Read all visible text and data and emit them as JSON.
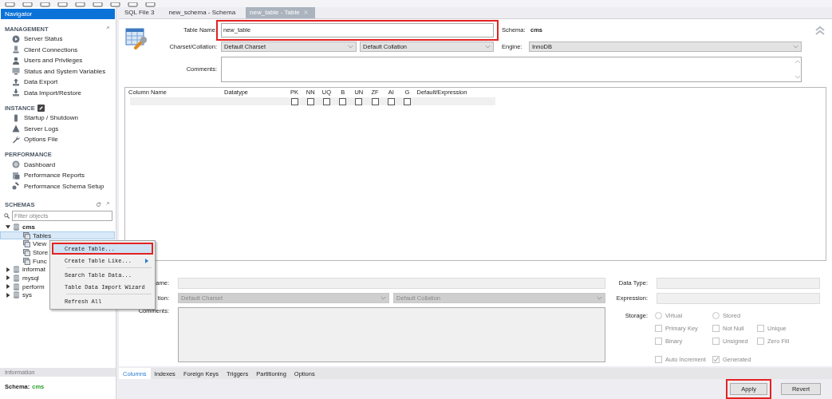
{
  "navigator": {
    "title": "Navigator",
    "sections": [
      {
        "title": "MANAGEMENT",
        "items": [
          "Server Status",
          "Client Connections",
          "Users and Privileges",
          "Status and System Variables",
          "Data Export",
          "Data Import/Restore"
        ]
      },
      {
        "title": "INSTANCE",
        "items": [
          "Startup / Shutdown",
          "Server Logs",
          "Options File"
        ]
      },
      {
        "title": "PERFORMANCE",
        "items": [
          "Dashboard",
          "Performance Reports",
          "Performance Schema Setup"
        ]
      }
    ]
  },
  "schemas": {
    "title": "SCHEMAS",
    "filter_placeholder": "Filter objects",
    "tree": [
      {
        "label": "cms",
        "expanded": true,
        "children": [
          {
            "label": "Tables",
            "selected": true
          },
          {
            "label": "View",
            "selected": false
          },
          {
            "label": "Store",
            "selected": false
          },
          {
            "label": "Func",
            "selected": false
          }
        ]
      },
      {
        "label": "informat",
        "expanded": false
      },
      {
        "label": "mysql",
        "expanded": false
      },
      {
        "label": "perform",
        "expanded": false
      },
      {
        "label": "sys",
        "expanded": false
      }
    ]
  },
  "context_menu": {
    "items": [
      {
        "kind": "item",
        "label": "Create Table...",
        "highlighted": true,
        "submenu": false
      },
      {
        "kind": "item",
        "label": "Create Table Like...",
        "highlighted": false,
        "submenu": true
      },
      {
        "kind": "separator"
      },
      {
        "kind": "item",
        "label": "Search Table Data...",
        "highlighted": false,
        "submenu": false
      },
      {
        "kind": "item",
        "label": "Table Data Import Wizard",
        "highlighted": false,
        "submenu": false
      },
      {
        "kind": "separator"
      },
      {
        "kind": "item",
        "label": "Refresh All",
        "highlighted": false,
        "submenu": false
      }
    ]
  },
  "information": {
    "title": "Information",
    "schema_label": "Schema:",
    "schema_value": "cms"
  },
  "tabs": [
    {
      "label": "SQL File 3",
      "selected": false,
      "closable": false
    },
    {
      "label": "new_schema - Schema",
      "selected": false,
      "closable": false
    },
    {
      "label": "new_table - Table",
      "selected": true,
      "closable": true
    }
  ],
  "table_editor": {
    "table_name_label": "Table Name:",
    "table_name": "new_table",
    "table_name_highlighted": true,
    "schema_label": "Schema:",
    "schema": "cms",
    "charset_label": "Charset/Collation:",
    "charset": "Default Charset",
    "collation": "Default Collation",
    "engine_label": "Engine:",
    "engine": "InnoDB",
    "comments_label": "Comments:"
  },
  "columns_grid": {
    "columns": [
      {
        "kind": "text",
        "label": "Column Name"
      },
      {
        "kind": "text",
        "label": "Datatype"
      },
      {
        "kind": "flag",
        "label": "PK",
        "checked": false
      },
      {
        "kind": "flag",
        "label": "NN",
        "checked": false
      },
      {
        "kind": "flag",
        "label": "UQ",
        "checked": false
      },
      {
        "kind": "flag",
        "label": "B",
        "checked": false
      },
      {
        "kind": "flag",
        "label": "UN",
        "checked": false
      },
      {
        "kind": "flag",
        "label": "ZF",
        "checked": false
      },
      {
        "kind": "flag",
        "label": "AI",
        "checked": false
      },
      {
        "kind": "flag",
        "label": "G",
        "checked": false
      },
      {
        "kind": "text",
        "label": "Default/Expression"
      }
    ]
  },
  "column_details": {
    "name_label": "ame:",
    "collation_label": "tion:",
    "charset": "Default Charset",
    "collation": "Default Collation",
    "comments_label": "Comments:",
    "data_type_label": "Data Type:",
    "expression_label": "Expression:",
    "storage_label": "Storage:",
    "storage_options": [
      {
        "label": "Virtual",
        "selected": false
      },
      {
        "label": "Stored",
        "selected": false
      }
    ],
    "flag_rows": [
      [
        {
          "label": "Primary Key",
          "checked": false
        },
        {
          "label": "Not Null",
          "checked": false
        },
        {
          "label": "Unique",
          "checked": false
        }
      ],
      [
        {
          "label": "Binary",
          "checked": false
        },
        {
          "label": "Unsigned",
          "checked": false
        },
        {
          "label": "Zero Fill",
          "checked": false
        }
      ],
      [
        {
          "label": "Auto Increment",
          "checked": false
        },
        {
          "label": "Generated",
          "checked": true
        }
      ]
    ]
  },
  "bottom_tabs": [
    {
      "label": "Columns",
      "selected": true
    },
    {
      "label": "Indexes",
      "selected": false
    },
    {
      "label": "Foreign Keys",
      "selected": false
    },
    {
      "label": "Triggers",
      "selected": false
    },
    {
      "label": "Partitioning",
      "selected": false
    },
    {
      "label": "Options",
      "selected": false
    }
  ],
  "buttons": [
    {
      "label": "Apply",
      "highlighted": true
    },
    {
      "label": "Revert",
      "highlighted": false
    }
  ]
}
